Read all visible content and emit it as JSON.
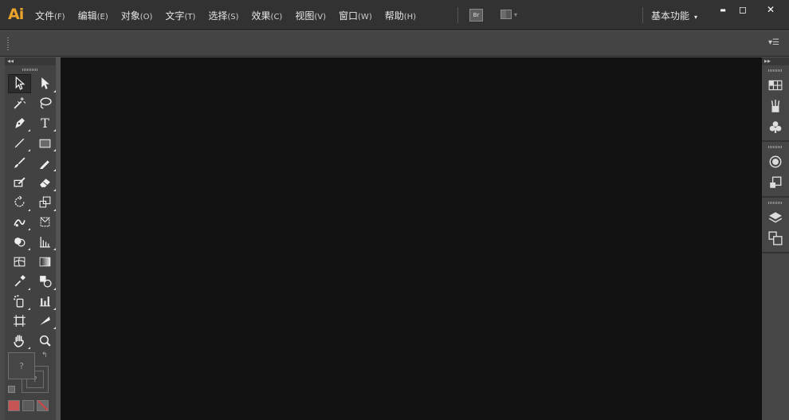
{
  "app": {
    "logo": "Ai",
    "brand_color": "#e8a32a"
  },
  "menubar": {
    "items": [
      {
        "label": "文件",
        "accel": "(F)"
      },
      {
        "label": "编辑",
        "accel": "(E)"
      },
      {
        "label": "对象",
        "accel": "(O)"
      },
      {
        "label": "文字",
        "accel": "(T)"
      },
      {
        "label": "选择",
        "accel": "(S)"
      },
      {
        "label": "效果",
        "accel": "(C)"
      },
      {
        "label": "视图",
        "accel": "(V)"
      },
      {
        "label": "窗口",
        "accel": "(W)"
      },
      {
        "label": "帮助",
        "accel": "(H)"
      }
    ],
    "bridge_label": "Br",
    "workspace_label": "基本功能",
    "dropdown_glyph": "▾",
    "window_buttons": {
      "minimize": "▬",
      "maximize": "◻",
      "close": "✕"
    }
  },
  "control_bar": {
    "panel_menu_glyph": "▾☰"
  },
  "toolbox": {
    "collapse_glyph": "◂◂",
    "tools": [
      {
        "name": "selection-tool-icon",
        "selected": true
      },
      {
        "name": "direct-selection-tool-icon"
      },
      {
        "name": "magic-wand-tool-icon"
      },
      {
        "name": "lasso-tool-icon"
      },
      {
        "name": "pen-tool-icon"
      },
      {
        "name": "type-tool-icon",
        "glyph": "T"
      },
      {
        "name": "line-segment-tool-icon"
      },
      {
        "name": "rectangle-tool-icon"
      },
      {
        "name": "paintbrush-tool-icon"
      },
      {
        "name": "pencil-tool-icon"
      },
      {
        "name": "blob-brush-tool-icon"
      },
      {
        "name": "eraser-tool-icon"
      },
      {
        "name": "rotate-tool-icon"
      },
      {
        "name": "scale-tool-icon"
      },
      {
        "name": "width-tool-icon"
      },
      {
        "name": "free-transform-tool-icon"
      },
      {
        "name": "shape-builder-tool-icon"
      },
      {
        "name": "perspective-grid-tool-icon"
      },
      {
        "name": "mesh-tool-icon"
      },
      {
        "name": "gradient-tool-icon"
      },
      {
        "name": "eyedropper-tool-icon"
      },
      {
        "name": "blend-tool-icon"
      },
      {
        "name": "symbol-sprayer-tool-icon"
      },
      {
        "name": "column-graph-tool-icon"
      },
      {
        "name": "artboard-tool-icon"
      },
      {
        "name": "slice-tool-icon"
      },
      {
        "name": "hand-tool-icon"
      },
      {
        "name": "zoom-tool-icon"
      }
    ],
    "fill_glyph": "?",
    "stroke_glyph": "?",
    "swap_glyph": "↰",
    "modes": [
      "color-mode",
      "gradient-mode",
      "none-mode"
    ],
    "mode_colors": [
      "#c75454",
      "#5a5a5a",
      "#c24a4a"
    ]
  },
  "right_dock": {
    "collapse_glyph": "▸▸",
    "groups": [
      [
        "swatches-panel-icon",
        "brushes-panel-icon",
        "symbols-panel-icon"
      ],
      [
        "appearance-panel-icon",
        "transform-panel-icon"
      ],
      [
        "layers-panel-icon",
        "artboards-panel-icon"
      ]
    ]
  }
}
